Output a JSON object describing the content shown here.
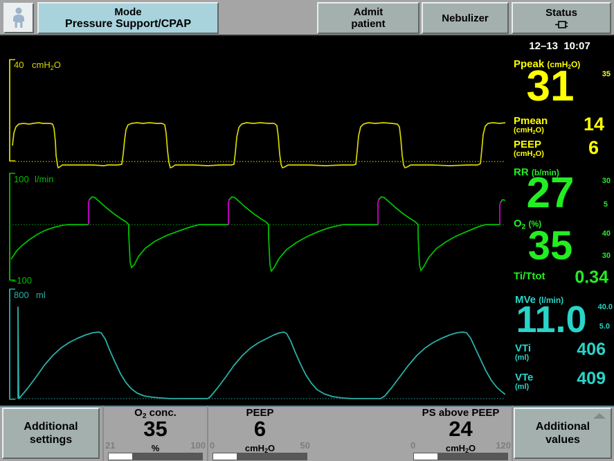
{
  "header": {
    "patient_icon": "child-patient-icon",
    "mode": {
      "title": "Mode",
      "value": "Pressure Support/CPAP"
    },
    "admit": {
      "line1": "Admit",
      "line2": "patient"
    },
    "nebulizer": "Nebulizer",
    "status": {
      "label": "Status",
      "icon": "power-plug-icon"
    }
  },
  "datetime": {
    "date": "12–13",
    "time": "10:07"
  },
  "waveforms": {
    "pressure": {
      "scale_max": "40",
      "unit": "cmH₂O",
      "color": "#d8d800"
    },
    "flow": {
      "scale_max": "100",
      "scale_min": "–100",
      "unit": "l/min",
      "color": "#00c000",
      "trigger_color": "#cc00cc"
    },
    "volume": {
      "scale_max": "800",
      "unit": "ml",
      "color": "#2ab0a8"
    }
  },
  "measurements": [
    {
      "name": "Ppeak",
      "unit": "(cmH₂O)",
      "value": "31",
      "scale_high": "35",
      "scale_low": "",
      "color": "yellow"
    },
    {
      "name": "Pmean",
      "unit": "(cmH₂O)",
      "value": "14",
      "color": "yellow"
    },
    {
      "name": "PEEP",
      "unit": "(cmH₂O)",
      "value": "6",
      "color": "yellow"
    },
    {
      "name": "RR",
      "unit": "(b/min)",
      "value": "27",
      "scale_high": "30",
      "scale_low": "5",
      "color": "green"
    },
    {
      "name": "O₂",
      "unit": "(%)",
      "value": "35",
      "scale_high": "40",
      "scale_low": "30",
      "color": "green"
    },
    {
      "name": "Ti/Ttot",
      "unit": "",
      "value": "0.34",
      "color": "green"
    },
    {
      "name": "MVe",
      "unit": "(l/min)",
      "value": "11.0",
      "scale_high": "40.0",
      "scale_low": "5.0",
      "color": "cyan"
    },
    {
      "name": "VTi",
      "unit": "(ml)",
      "value": "406",
      "color": "cyan"
    },
    {
      "name": "VTe",
      "unit": "(ml)",
      "value": "409",
      "color": "cyan"
    }
  ],
  "footer": {
    "additional_settings": {
      "line1": "Additional",
      "line2": "settings"
    },
    "additional_values": {
      "line1": "Additional",
      "line2": "values"
    },
    "params": [
      {
        "name": "O₂ conc.",
        "value": "35",
        "unit": "%",
        "min": "21",
        "max": "100"
      },
      {
        "name": "PEEP",
        "value": "6",
        "unit": "cmH₂O",
        "min": "0",
        "max": "50"
      },
      {
        "name": "PS above PEEP",
        "value": "24",
        "unit": "cmH₂O",
        "min": "0",
        "max": "120"
      }
    ]
  },
  "colors": {
    "pressure": "#ffff00",
    "flow": "#00e000",
    "volume": "#2ad4c8",
    "panel_bg": "#a5a5a5",
    "button_bg": "#a3b0ae",
    "mode_bg": "#a8d3dd"
  }
}
